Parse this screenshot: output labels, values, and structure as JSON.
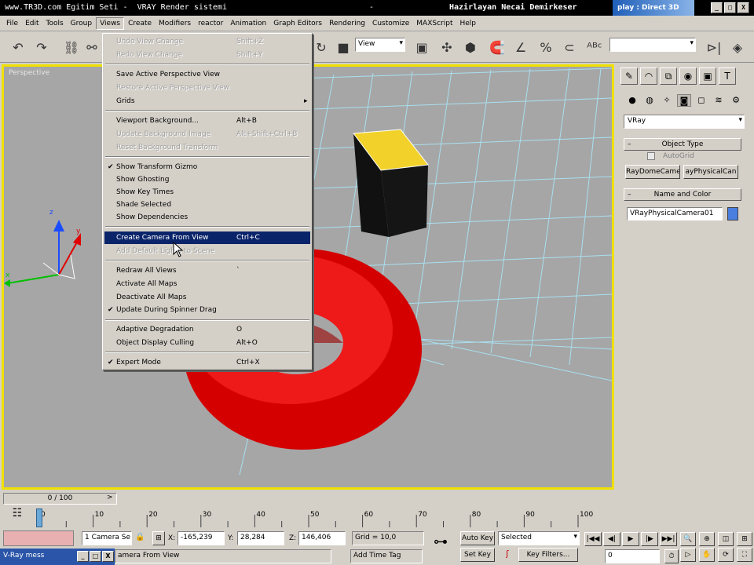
{
  "titlebar": {
    "left": "www.TR3D.com Egitim Seti -  VRAY Render sistemi",
    "mid": "-",
    "right": "Hazirlayan Necai Demirkeser",
    "tail": "play : Direct 3D",
    "buttons": [
      "_",
      "□",
      "X"
    ]
  },
  "menubar": {
    "items": [
      "File",
      "Edit",
      "Tools",
      "Group",
      "Views",
      "Create",
      "Modifiers",
      "reactor",
      "Animation",
      "Graph Editors",
      "Rendering",
      "Customize",
      "MAXScript",
      "Help"
    ]
  },
  "toolbar": {
    "ref_coord": "View",
    "named_sel": ""
  },
  "viewport": {
    "label": "Perspective",
    "axis_x": "x",
    "axis_y": "y",
    "axis_z": "z"
  },
  "views_menu": {
    "items": [
      {
        "label": "Undo View Change",
        "shortcut": "Shift+Z",
        "disabled": true
      },
      {
        "label": "Redo View Change",
        "shortcut": "Shift+Y",
        "disabled": true
      },
      {
        "label": "Save Active Perspective View",
        "shortcut": ""
      },
      {
        "label": "Restore Active Perspective View",
        "shortcut": "",
        "disabled": true
      },
      {
        "label": "Grids",
        "shortcut": "",
        "submenu": true
      },
      {
        "label": "Viewport Background...",
        "shortcut": "Alt+B"
      },
      {
        "label": "Update Background Image",
        "shortcut": "Alt+Shift+Ctrl+B",
        "disabled": true
      },
      {
        "label": "Reset Background Transform",
        "shortcut": "",
        "disabled": true
      },
      {
        "label": "Show Transform Gizmo",
        "shortcut": "",
        "checked": true
      },
      {
        "label": "Show Ghosting",
        "shortcut": ""
      },
      {
        "label": "Show Key Times",
        "shortcut": ""
      },
      {
        "label": "Shade Selected",
        "shortcut": ""
      },
      {
        "label": "Show Dependencies",
        "shortcut": ""
      },
      {
        "label": "Create Camera From View",
        "shortcut": "Ctrl+C",
        "highlighted": true
      },
      {
        "label": "Add Default Lights to Scene",
        "shortcut": "",
        "disabled": true
      },
      {
        "label": "Redraw All Views",
        "shortcut": "`"
      },
      {
        "label": "Activate All Maps",
        "shortcut": ""
      },
      {
        "label": "Deactivate All Maps",
        "shortcut": ""
      },
      {
        "label": "Update During Spinner Drag",
        "shortcut": "",
        "checked": true
      },
      {
        "label": "Adaptive Degradation",
        "shortcut": "O"
      },
      {
        "label": "Object Display Culling",
        "shortcut": "Alt+O"
      },
      {
        "label": "Expert Mode",
        "shortcut": "Ctrl+X",
        "checked": true
      }
    ]
  },
  "command_panel": {
    "category": "VRay",
    "object_type_title": "Object Type",
    "autogrid": "AutoGrid",
    "btn_dome": "RayDomeCame",
    "btn_physical": "ayPhysicalCan",
    "name_color_title": "Name and Color",
    "name_value": "VRayPhysicalCamera01",
    "swatch_color": "#4a7fe0"
  },
  "timeline": {
    "slider": "0 / 100",
    "ticks": [
      "0",
      "10",
      "20",
      "30",
      "40",
      "50",
      "60",
      "70",
      "80",
      "90",
      "100"
    ]
  },
  "status": {
    "selection": "1 Camera Se",
    "x_label": "X:",
    "x": "-165,239",
    "y_label": "Y:",
    "y": "28,284",
    "z_label": "Z:",
    "z": "146,406",
    "grid": "Grid = 10,0",
    "prompt": "amera From View",
    "add_time_tag": "Add Time Tag",
    "auto_key": "Auto Key",
    "auto_key_mode": "Selected",
    "set_key": "Set Key",
    "key_filters": "Key Filters...",
    "frame": "0",
    "taskbar_label": "V-Ray mess"
  }
}
